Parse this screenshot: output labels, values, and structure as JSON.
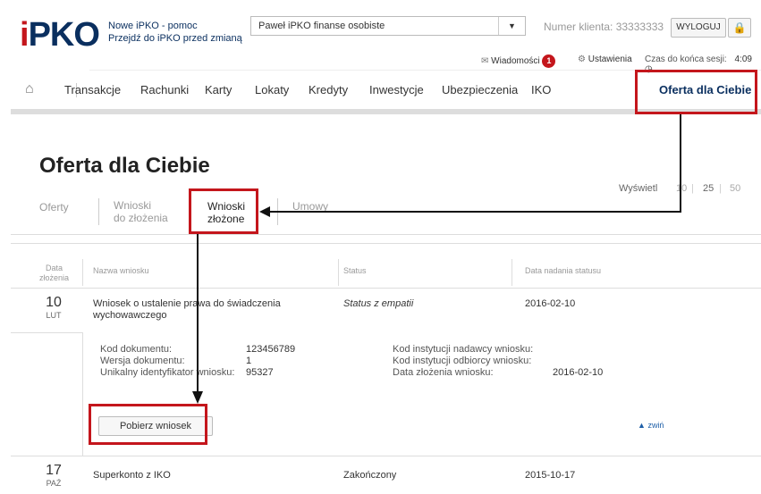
{
  "header": {
    "logo_i": "i",
    "logo_text": "PKO",
    "help_link": "Nowe iPKO - pomoc",
    "switch_link": "Przejdź do iPKO przed zmianą",
    "context_select": "Paweł iPKO finanse osobiste",
    "client_number": "Numer klienta: 33333333",
    "logout": "WYLOGUJ",
    "messages_label": "Wiadomości",
    "messages_count": "1",
    "settings_label": "Ustawienia",
    "session_label": "Czas do końca sesji:",
    "session_time": "4:09"
  },
  "nav": {
    "items": [
      "Transakcje",
      "Rachunki",
      "Karty",
      "Lokaty",
      "Kredyty",
      "Inwestycje",
      "Ubezpieczenia",
      "IKO"
    ],
    "active": "Oferta dla Ciebie"
  },
  "page": {
    "title": "Oferta dla Ciebie",
    "tabs": [
      {
        "label": "Oferty"
      },
      {
        "line1": "Wnioski",
        "line2": "do złożenia"
      },
      {
        "line1": "Wnioski",
        "line2": "złożone"
      },
      {
        "label": "Umowy"
      }
    ],
    "show_label": "Wyświetl",
    "page_sizes": [
      "10",
      "25",
      "50"
    ],
    "selected_size": "25"
  },
  "table": {
    "headers": {
      "date_line1": "Data",
      "date_line2": "złożenia",
      "name": "Nazwa wniosku",
      "status": "Status",
      "status_date": "Data nadania statusu"
    },
    "rows": [
      {
        "day": "10",
        "month": "LUT",
        "name_line1": "Wniosek o ustalenie prawa do świadczenia",
        "name_line2": "wychowawczego",
        "status": "Status z empatii",
        "status_date": "2016-02-10"
      },
      {
        "day": "17",
        "month": "PAŹ",
        "name_line1": "Superkonto z IKO",
        "status": "Zakończony",
        "status_date": "2015-10-17"
      }
    ],
    "details": {
      "doc_code_label": "Kod dokumentu:",
      "doc_code": "123456789",
      "doc_version_label": "Wersja dokumentu:",
      "doc_version": "1",
      "unique_id_label": "Unikalny identyfikator wniosku:",
      "unique_id": "95327",
      "sender_code_label": "Kod instytucji nadawcy wniosku:",
      "receiver_code_label": "Kod instytucji odbiorcy wniosku:",
      "submit_date_label": "Data złożenia wniosku:",
      "submit_date": "2016-02-10",
      "download_button": "Pobierz wniosek",
      "collapse": "zwiń"
    }
  },
  "colors": {
    "brand_navy": "#0a2f5f",
    "brand_red": "#c4161c",
    "link_blue": "#1e5fa8"
  }
}
